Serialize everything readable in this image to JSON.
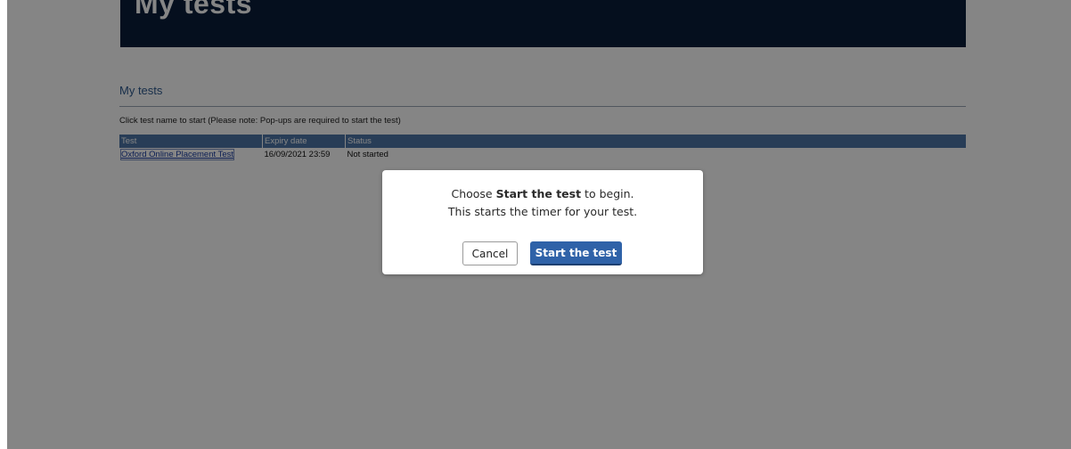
{
  "banner": {
    "title": "My tests"
  },
  "section": {
    "title": "My tests",
    "instruction": "Click test name to start (Please note: Pop-ups are required to start the test)"
  },
  "table": {
    "columns": [
      "Test",
      "Expiry date",
      "Status"
    ],
    "rows": [
      {
        "test": "Oxford Online Placement Test",
        "expiry": "16/09/2021 23:59",
        "status": "Not started"
      }
    ]
  },
  "modal": {
    "line1_prefix": "Choose ",
    "line1_bold": "Start the test",
    "line1_suffix": " to begin.",
    "line2": "This starts the timer for your test.",
    "cancel_label": "Cancel",
    "start_label": "Start the test"
  },
  "colors": {
    "banner_bg": "#0b1e3a",
    "header_bg": "#4d76a8",
    "primary_button": "#2f62a8",
    "overlay": "rgba(0,0,0,0.48)"
  }
}
